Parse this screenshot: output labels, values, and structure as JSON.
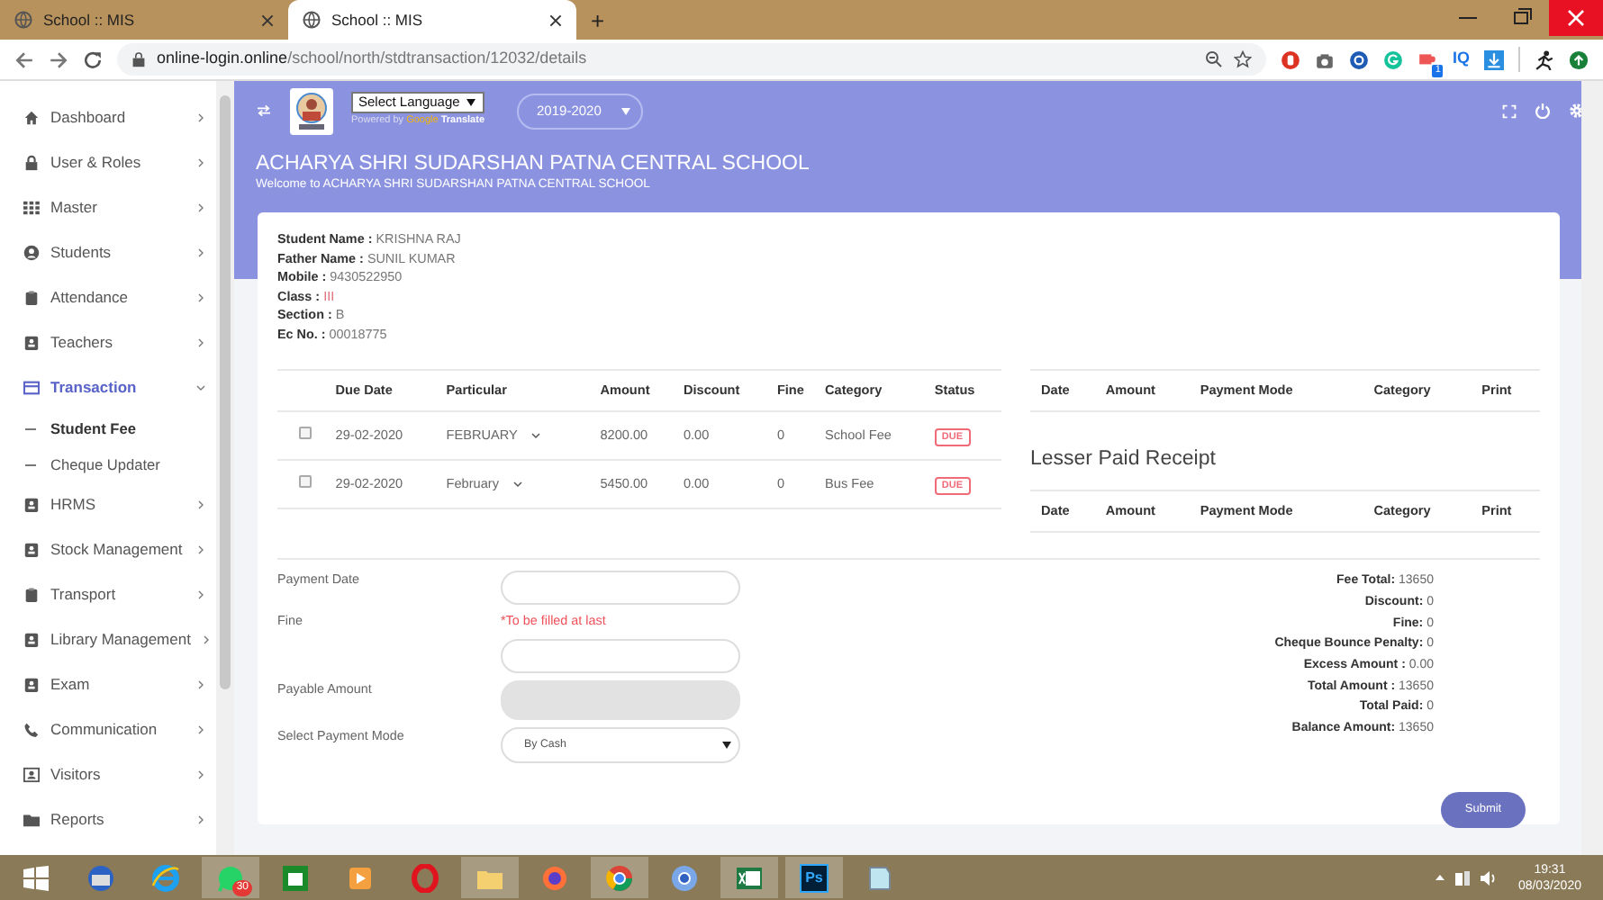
{
  "browser": {
    "tabs": [
      {
        "title": "School :: MIS",
        "selected": false
      },
      {
        "title": "School :: MIS",
        "selected": true
      }
    ],
    "new_tab": "+",
    "url_host": "online-login.online",
    "url_path": "/school/north/stdtransaction/12032/details",
    "extension_label": "IQ",
    "extension_badge": "1"
  },
  "topbar": {
    "language_select": "Select Language",
    "powered_by": "Powered by",
    "google": "Google",
    "translate": "Translate",
    "session": "2019-2020"
  },
  "sidebar": {
    "items": [
      {
        "label": "Dashboard",
        "selected": false,
        "expanded": false
      },
      {
        "label": "User & Roles",
        "selected": false,
        "expanded": false
      },
      {
        "label": "Master",
        "selected": false,
        "expanded": false
      },
      {
        "label": "Students",
        "selected": false,
        "expanded": false
      },
      {
        "label": "Attendance",
        "selected": false,
        "expanded": false
      },
      {
        "label": "Teachers",
        "selected": false,
        "expanded": false
      },
      {
        "label": "Transaction",
        "selected": true,
        "expanded": true,
        "children": [
          {
            "label": "Student Fee",
            "selected": true
          },
          {
            "label": "Cheque Updater",
            "selected": false
          }
        ]
      },
      {
        "label": "HRMS",
        "selected": false,
        "expanded": false
      },
      {
        "label": "Stock Management",
        "selected": false,
        "expanded": false
      },
      {
        "label": "Transport",
        "selected": false,
        "expanded": false
      },
      {
        "label": "Library Management",
        "selected": false,
        "expanded": false
      },
      {
        "label": "Exam",
        "selected": false,
        "expanded": false
      },
      {
        "label": "Communication",
        "selected": false,
        "expanded": false
      },
      {
        "label": "Visitors",
        "selected": false,
        "expanded": false
      },
      {
        "label": "Reports",
        "selected": false,
        "expanded": false
      }
    ]
  },
  "header": {
    "title": "ACHARYA SHRI SUDARSHAN PATNA CENTRAL SCHOOL",
    "welcome": "Welcome to ACHARYA SHRI SUDARSHAN PATNA CENTRAL SCHOOL"
  },
  "student": [
    {
      "label": "Student Name :",
      "value": "KRISHNA RAJ"
    },
    {
      "label": "Father Name :",
      "value": "SUNIL KUMAR"
    },
    {
      "label": "Mobile :",
      "value": "9430522950"
    },
    {
      "label": "Class :",
      "value": "III",
      "color": "#e0707a"
    },
    {
      "label": "Section :",
      "value": "B"
    },
    {
      "label": "Ec No. :",
      "value": "00018775"
    }
  ],
  "fees": {
    "columns": [
      "Due Date",
      "Particular",
      "Amount",
      "Discount",
      "Fine",
      "Category",
      "Status"
    ],
    "rows": [
      {
        "checked": false,
        "due_date": "29-02-2020",
        "particular": "FEBRUARY",
        "amount": "8200.00",
        "discount": "0.00",
        "fine": "0",
        "category": "School Fee",
        "status": "DUE"
      },
      {
        "checked": false,
        "due_date": "29-02-2020",
        "particular": "February",
        "amount": "5450.00",
        "discount": "0.00",
        "fine": "0",
        "category": "Bus Fee",
        "status": "DUE"
      }
    ]
  },
  "receipts": {
    "columns": [
      "Date",
      "Amount",
      "Payment Mode",
      "Category",
      "Print"
    ]
  },
  "lesser_paid": {
    "title": "Lesser Paid Receipt",
    "columns": [
      "Date",
      "Amount",
      "Payment Mode",
      "Category",
      "Print"
    ]
  },
  "form": {
    "payment_date": {
      "label": "Payment Date"
    },
    "fine": {
      "label": "Fine",
      "note": "*To be filled at last"
    },
    "payable": {
      "label": "Payable Amount",
      "disabled": true
    },
    "payment_mode": {
      "label": "Select Payment Mode",
      "value": "By Cash"
    }
  },
  "summary": [
    {
      "label": "Fee Total:",
      "value": "13650"
    },
    {
      "label": "Discount:",
      "value": "0"
    },
    {
      "label": "Fine:",
      "value": "0"
    },
    {
      "label": "Cheque Bounce Penalty:",
      "value": "0"
    },
    {
      "label": "Excess Amount :",
      "value": "0.00"
    },
    {
      "label": "Total Amount :",
      "value": "13650"
    },
    {
      "label": "Total Paid:",
      "value": "0"
    },
    {
      "label": "Balance Amount:",
      "value": "13650"
    }
  ],
  "submit": "Submit",
  "taskbar": {
    "whatsapp_badge": "30",
    "photoshop_label": "Ps",
    "time": "19:31",
    "date": "08/03/2020"
  }
}
